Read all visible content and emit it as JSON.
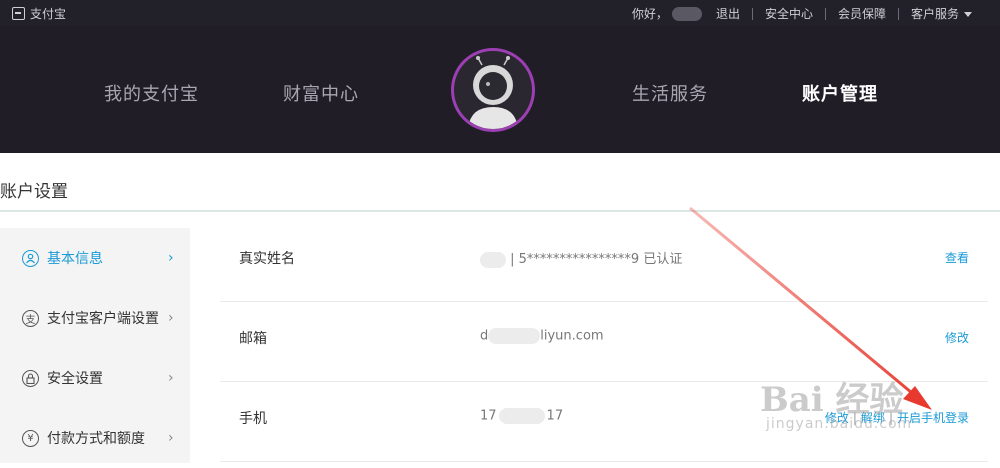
{
  "topbar": {
    "brand": "支付宝",
    "greeting": "你好，",
    "logout": "退出",
    "security_center": "安全中心",
    "member_guarantee": "会员保障",
    "customer_service": "客户服务"
  },
  "nav": {
    "items": [
      {
        "label": "我的支付宝"
      },
      {
        "label": "财富中心"
      },
      {
        "label": "生活服务"
      },
      {
        "label": "账户管理"
      }
    ],
    "active": "账户管理"
  },
  "page": {
    "title": "账户设置"
  },
  "sidebar": {
    "items": [
      {
        "label": "基本信息",
        "icon": "user-icon"
      },
      {
        "label": "支付宝客户端设置",
        "icon": "currency-icon"
      },
      {
        "label": "安全设置",
        "icon": "lock-icon"
      },
      {
        "label": "付款方式和额度",
        "icon": "yen-icon"
      }
    ]
  },
  "rows": [
    {
      "label": "真实姓名",
      "value": "| 5****************9 已认证",
      "action": "查看"
    },
    {
      "label": "邮箱",
      "value_prefix": "d",
      "value_suffix": "liyun.com",
      "action": "修改"
    },
    {
      "label": "手机",
      "value_prefix": "17",
      "value_suffix": "17",
      "actions": [
        "修改",
        "解绑",
        "开启手机登录"
      ]
    }
  ],
  "watermark": {
    "main": "Bai 经验",
    "sub": "jingyan.baidu.com"
  },
  "colors": {
    "accent": "#1a9ad6",
    "nav_bg": "#201d27",
    "arrow": "#e8392e"
  }
}
